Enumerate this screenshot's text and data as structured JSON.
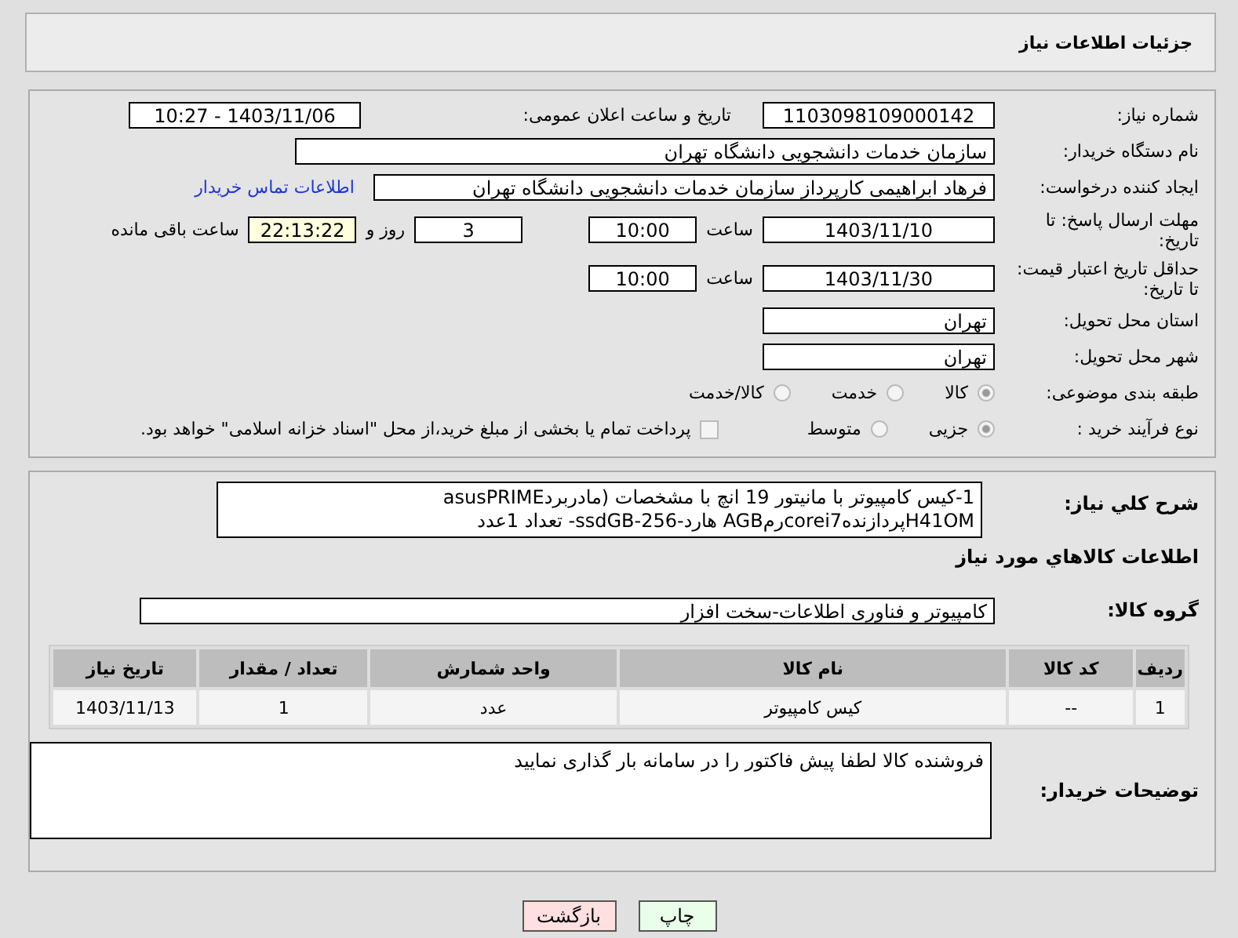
{
  "header": {
    "title": "جزئیات اطلاعات نیاز"
  },
  "need_number": {
    "label": "شماره نیاز:",
    "value": "1103098109000142"
  },
  "announce": {
    "label": "تاریخ و ساعت اعلان عمومی:",
    "value": "1403/11/06 - 10:27"
  },
  "buyer_org": {
    "label": "نام دستگاه خریدار:",
    "value": "سازمان خدمات دانشجویی دانشگاه تهران"
  },
  "requester": {
    "label": "ایجاد کننده درخواست:",
    "value": "فرهاد ابراهیمی کارپرداز سازمان خدمات دانشجویی دانشگاه تهران",
    "link": "اطلاعات تماس خریدار"
  },
  "deadline": {
    "label": "مهلت ارسال پاسخ: تا تاریخ:",
    "date": "1403/11/10",
    "time_label": "ساعت",
    "time": "10:00",
    "days": "3",
    "days_label": "روز و",
    "remaining": "22:13:22",
    "remaining_label": "ساعت باقی مانده"
  },
  "validity": {
    "label": "حداقل تاریخ اعتبار قیمت: تا تاریخ:",
    "date": "1403/11/30",
    "time_label": "ساعت",
    "time": "10:00"
  },
  "province": {
    "label": "استان محل تحویل:",
    "value": "تهران"
  },
  "city": {
    "label": "شهر محل تحویل:",
    "value": "تهران"
  },
  "category": {
    "label": "طبقه بندی موضوعی:",
    "options": [
      {
        "label": "کالا",
        "selected": true
      },
      {
        "label": "خدمت",
        "selected": false
      },
      {
        "label": "کالا/خدمت",
        "selected": false
      }
    ]
  },
  "process": {
    "label": "نوع فرآیند خرید :",
    "options": [
      {
        "label": "جزیی",
        "selected": true
      },
      {
        "label": "متوسط",
        "selected": false
      }
    ],
    "payment": {
      "label": "پرداخت تمام یا بخشی از مبلغ خرید،از محل \"اسناد خزانه اسلامی\" خواهد بود.",
      "checked": false
    }
  },
  "description": {
    "label": "شرح کلي نياز:",
    "text": "1-کیس کامپیوتر با مانیتور 19 انچ با مشخصات (مادربردasusPRIME H41OMپردازندهcorei7رمAGB هارد-ssdGB-256- تعداد  1عدد"
  },
  "items_title": "اطلاعات کالاهاي مورد نياز",
  "goods_group": {
    "label": "گروه کالا:",
    "value": "کامپیوتر و فناوری اطلاعات-سخت افزار"
  },
  "table": {
    "columns": [
      "ردیف",
      "کد کالا",
      "نام کالا",
      "واحد شمارش",
      "تعداد / مقدار",
      "تاریخ نیاز"
    ],
    "rows": [
      [
        "1",
        "--",
        "کیس کامپیوتر",
        "عدد",
        "1",
        "1403/11/13"
      ]
    ]
  },
  "buyer_notes": {
    "label": "توضیحات خریدار:",
    "text": "فروشنده کالا لطفا پیش فاکتور را در سامانه بار گذاری نمایید"
  },
  "buttons": [
    {
      "label": "چاپ",
      "kind": "print"
    },
    {
      "label": "بازگشت",
      "kind": "back"
    }
  ]
}
